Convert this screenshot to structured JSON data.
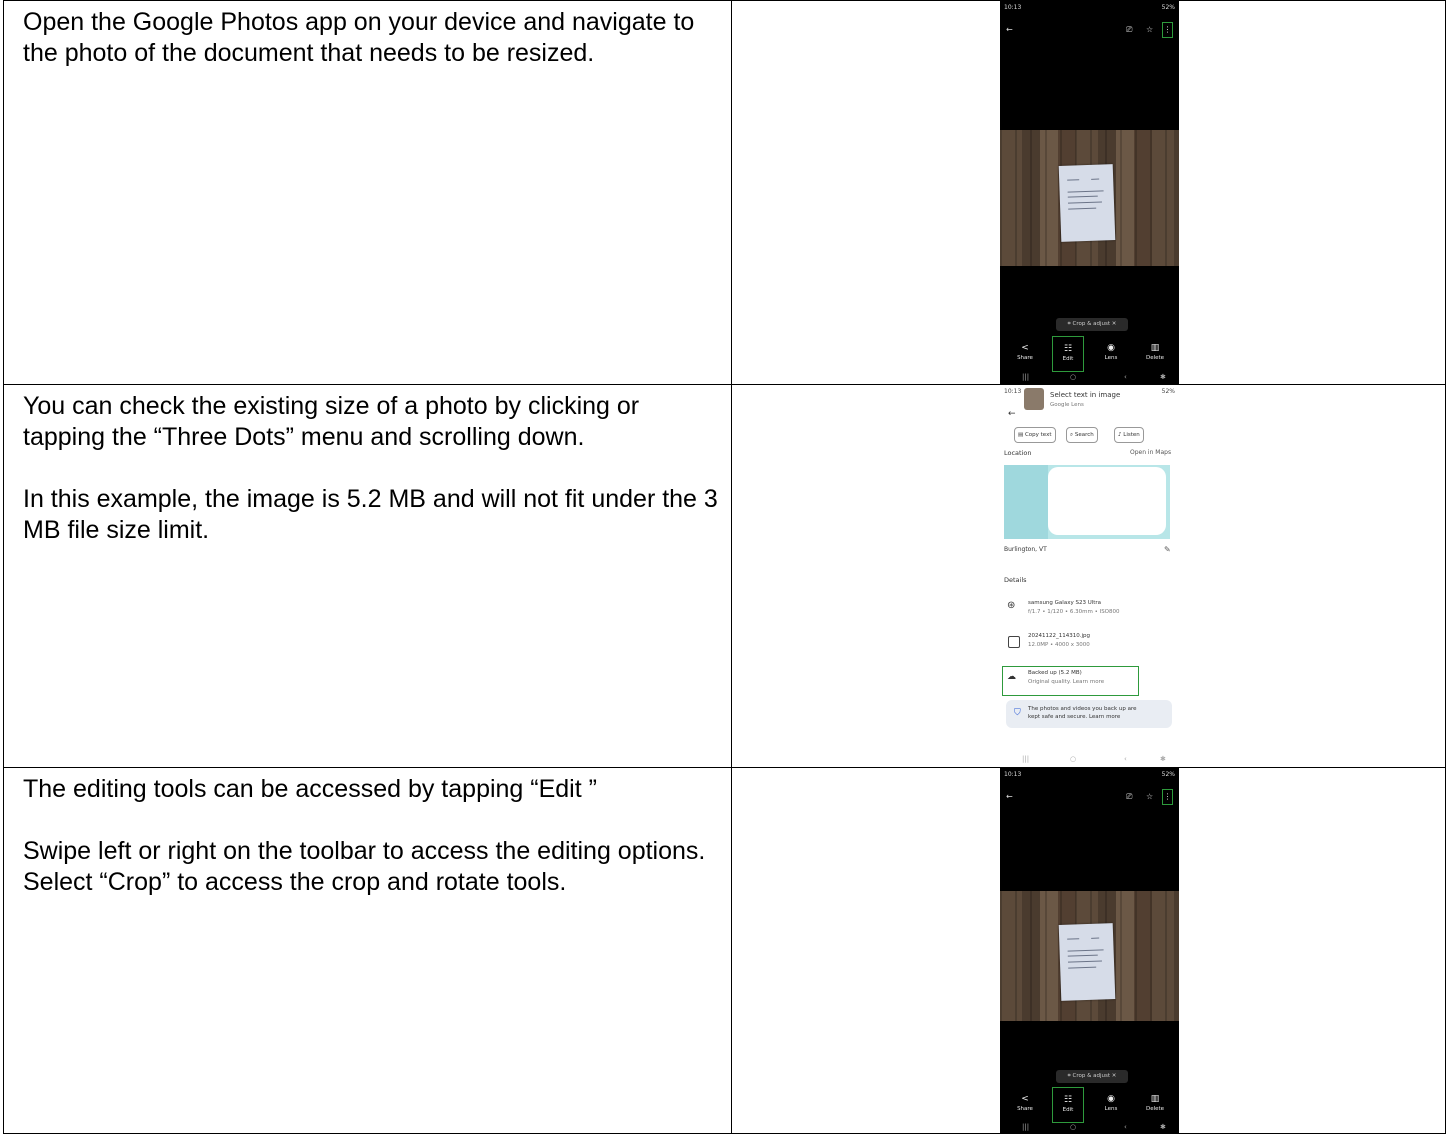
{
  "rows": [
    {
      "text": [
        "Open the Google Photos app on your device and navigate to the photo of the document that needs to be resized."
      ]
    },
    {
      "text": [
        "You can check the existing size of a photo by clicking or tapping the “Three Dots” menu and scrolling down.",
        "In this example, the image is 5.2 MB and will not fit under the 3 MB file size limit."
      ]
    },
    {
      "text": [
        "The editing tools can be accessed by tapping “Edit ”",
        "Swipe left or right on the toolbar to access the editing options. Select “Crop” to access the crop and rotate tools."
      ]
    }
  ],
  "phone": {
    "status_time": "10:13",
    "status_battery": "52%",
    "crop_chip": "Crop & adjust",
    "actions": {
      "share": "Share",
      "edit": "Edit",
      "lens": "Lens",
      "delete": "Delete"
    },
    "highlight_color": "#2e9a3c"
  },
  "info_panel": {
    "select_text": "Select text in image",
    "google_lens": "Google Lens",
    "chips": [
      "Copy text",
      "Search",
      "Listen"
    ],
    "location_label": "Location",
    "open_maps": "Open in Maps",
    "place": "Burlington, VT",
    "details_label": "Details",
    "camera": "samsung Galaxy S23 Ultra",
    "camera_specs": "f/1.7 • 1/120 • 6.30mm • ISO800",
    "file_name": "20241122_114310.jpg",
    "file_specs": "12.0MP • 4000 x 3000",
    "backup": "Backed up (5.2 MB)",
    "backup_sub": "Original quality. Learn more",
    "secure_line1": "The photos and videos you back up are",
    "secure_line2": "kept safe and secure. Learn more"
  }
}
